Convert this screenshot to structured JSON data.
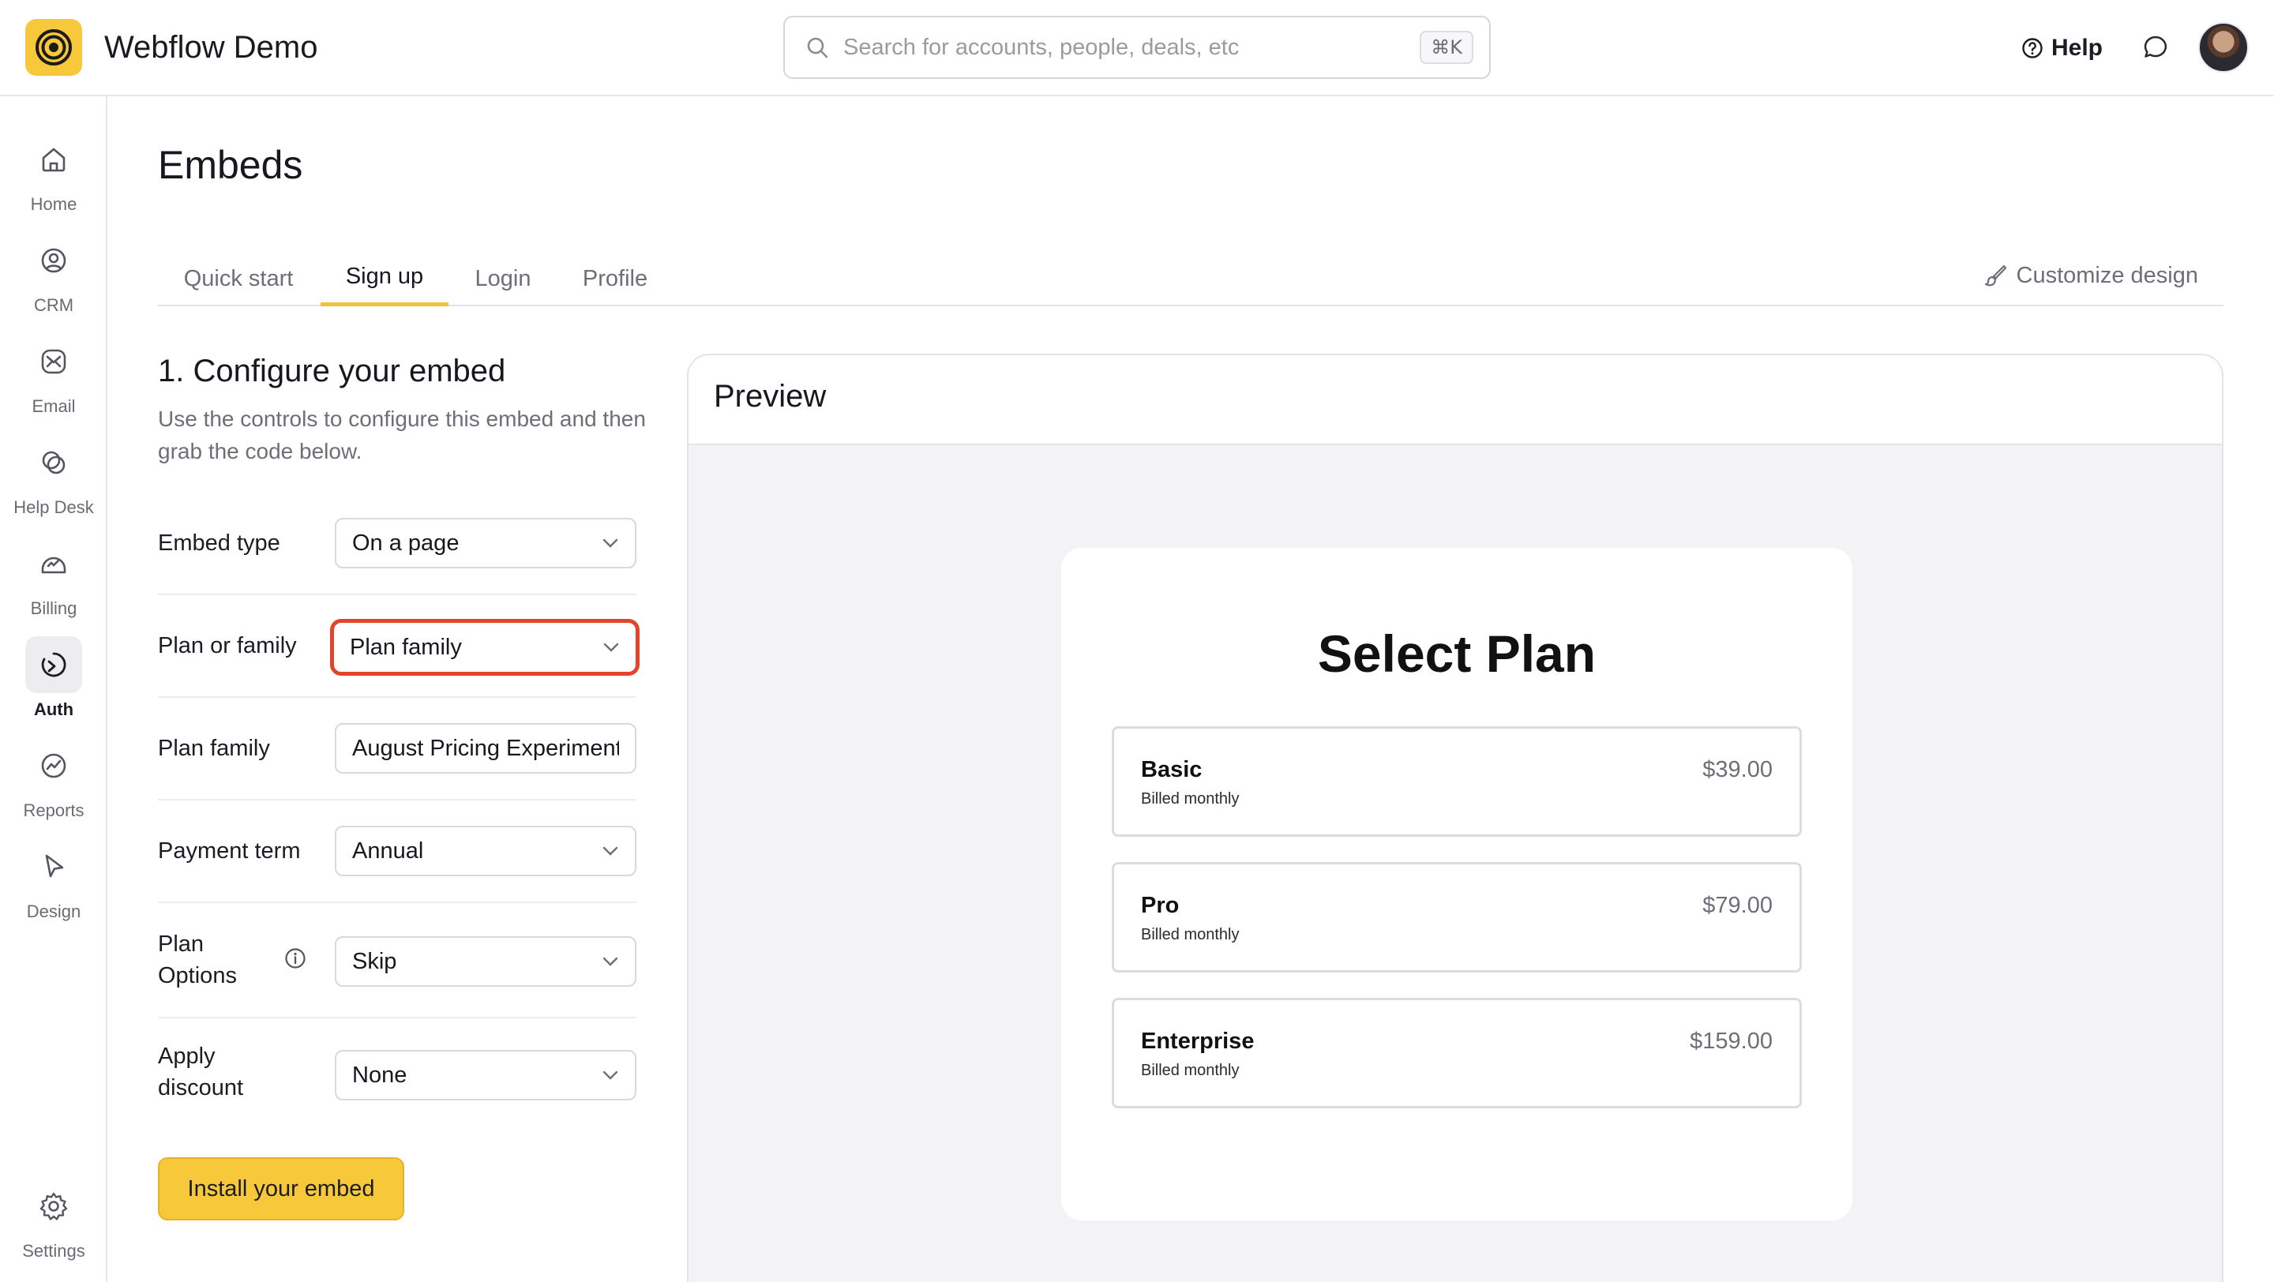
{
  "app": {
    "title": "Webflow Demo"
  },
  "search": {
    "placeholder": "Search for accounts, people, deals, etc",
    "shortcut": "⌘K"
  },
  "header": {
    "help_label": "Help"
  },
  "sidebar": {
    "items": [
      {
        "label": "Home",
        "icon": "home-icon"
      },
      {
        "label": "CRM",
        "icon": "crm-icon"
      },
      {
        "label": "Email",
        "icon": "email-icon"
      },
      {
        "label": "Help Desk",
        "icon": "help-desk-icon"
      },
      {
        "label": "Billing",
        "icon": "billing-icon"
      },
      {
        "label": "Auth",
        "icon": "auth-icon",
        "active": true
      },
      {
        "label": "Reports",
        "icon": "reports-icon"
      },
      {
        "label": "Design",
        "icon": "design-icon"
      }
    ],
    "settings_label": "Settings"
  },
  "page": {
    "title": "Embeds"
  },
  "tabs": [
    {
      "label": "Quick start"
    },
    {
      "label": "Sign up",
      "active": true
    },
    {
      "label": "Login"
    },
    {
      "label": "Profile"
    }
  ],
  "customize_label": "Customize design",
  "configure": {
    "title": "1. Configure your embed",
    "description": "Use the controls to configure this embed and then grab the code below.",
    "rows": [
      {
        "label": "Embed type",
        "value": "On a page",
        "type": "select"
      },
      {
        "label": "Plan or family",
        "value": "Plan family",
        "type": "select",
        "highlighted": true
      },
      {
        "label": "Plan family",
        "value": "August Pricing Experiment",
        "type": "text"
      },
      {
        "label": "Payment term",
        "value": "Annual",
        "type": "select"
      },
      {
        "label": "Plan Options",
        "value": "Skip",
        "type": "select"
      },
      {
        "label": "Apply discount",
        "value": "None",
        "type": "select"
      }
    ],
    "install_label": "Install your embed"
  },
  "preview": {
    "title": "Preview",
    "heading": "Select Plan",
    "plans": [
      {
        "name": "Basic",
        "term": "Billed monthly",
        "price": "$39.00"
      },
      {
        "name": "Pro",
        "term": "Billed monthly",
        "price": "$79.00"
      },
      {
        "name": "Enterprise",
        "term": "Billed monthly",
        "price": "$159.00"
      }
    ]
  },
  "colors": {
    "accent": "#f6c83a",
    "focus_ring": "#e2452a",
    "preview_bg": "#f3f3f5"
  }
}
